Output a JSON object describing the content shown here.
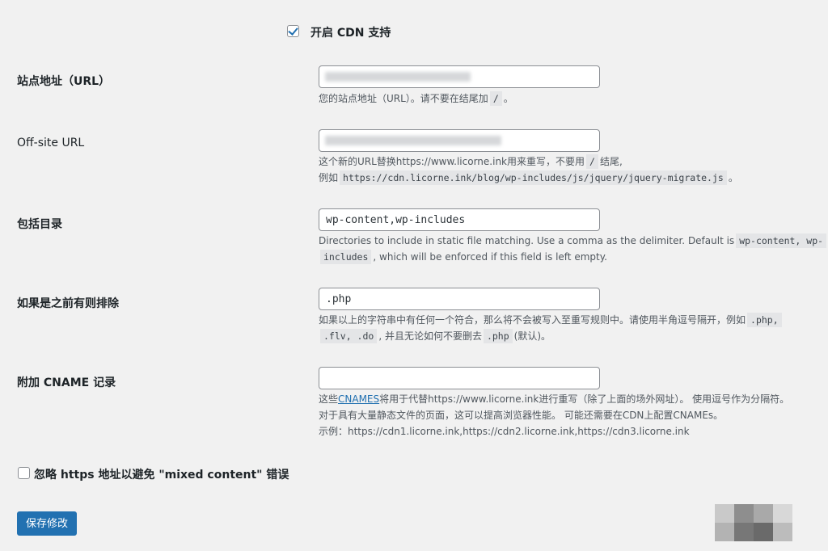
{
  "enable_cdn": {
    "label": "开启 CDN 支持",
    "checked": true
  },
  "fields": {
    "site_url": {
      "label": "站点地址（URL）",
      "value": "",
      "desc_pre": "您的站点地址（URL）。请不要在结尾加",
      "desc_code": "/",
      "desc_post": "。"
    },
    "offsite_url": {
      "label": "Off-site URL",
      "value": "",
      "desc_line1_pre": "这个新的URL替换https://www.licorne.ink用来重写，不要用",
      "desc_line1_code": "/",
      "desc_line1_post": "结尾,",
      "desc_line2_pre": "例如",
      "desc_line2_code": "https://cdn.licorne.ink/blog/wp-includes/js/jquery/jquery-migrate.js",
      "desc_line2_post": "。"
    },
    "include_dirs": {
      "label": "包括目录",
      "value": "wp-content,wp-includes",
      "desc_line1_pre": "Directories to include in static file matching. Use a comma as the delimiter. Default is",
      "desc_line1_code": "wp-content, wp-",
      "desc_line2_code": "includes",
      "desc_line2_post": ", which will be enforced if this field is left empty."
    },
    "exclude_if": {
      "label": "如果是之前有则排除",
      "value": ".php",
      "desc_line1_pre": "如果以上的字符串中有任何一个符合，那么将不会被写入至重写规则中。请使用半角逗号隔开，例如",
      "desc_line1_code": ".php,",
      "desc_line2_code1": ".flv, .do",
      "desc_line2_mid": ", 并且无论如何不要删去",
      "desc_line2_code2": ".php",
      "desc_line2_post": "(默认)。"
    },
    "cname": {
      "label": "附加 CNAME 记录",
      "value": "",
      "desc_line1_pre": "这些",
      "desc_line1_link": "CNAMES",
      "desc_line1_post": "将用于代替https://www.licorne.ink进行重写（除了上面的场外网址）。 使用逗号作为分隔符。",
      "desc_line2": "对于具有大量静态文件的页面，这可以提高浏览器性能。 可能还需要在CDN上配置CNAMEs。",
      "desc_line3": "示例：https://cdn1.licorne.ink,https://cdn2.licorne.ink,https://cdn3.licorne.ink"
    }
  },
  "ignore_https": {
    "label": "忽略 https 地址以避免 \"mixed content\" 错误",
    "checked": false
  },
  "save_button": "保存修改",
  "colors": {
    "accent": "#2271b1",
    "background": "#f1f1f1",
    "text": "#1d2327"
  }
}
